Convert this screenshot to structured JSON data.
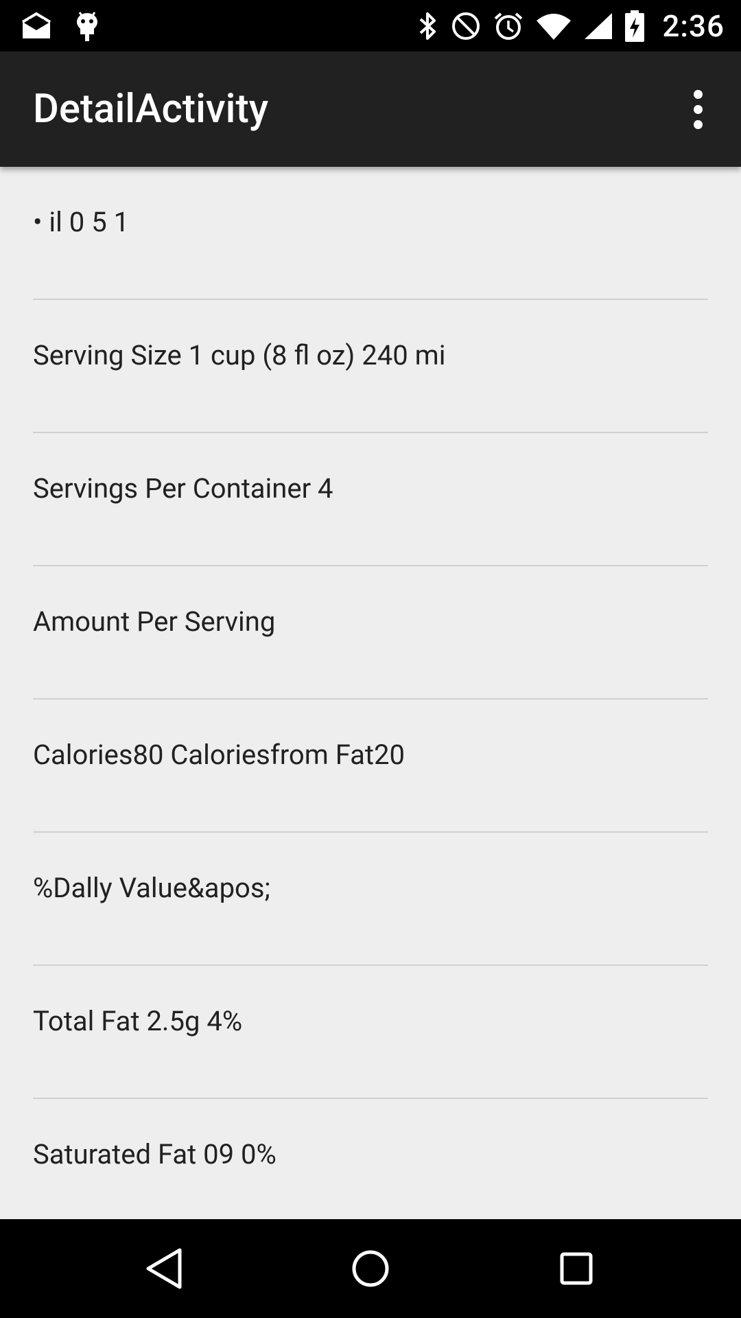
{
  "status_bar": {
    "time": "2:36",
    "icons": [
      "mail-icon",
      "android-debug-icon",
      "bluetooth-icon",
      "do-not-disturb-icon",
      "alarm-icon",
      "wifi-icon",
      "cell-signal-icon",
      "battery-charging-icon"
    ]
  },
  "app_bar": {
    "title": "DetailActivity",
    "overflow_icon": "more-vert-icon"
  },
  "list": {
    "items": [
      {
        "text": "• il 0 5 1"
      },
      {
        "text": "Serving Size 1 cup (8 fl oz) 240 mi"
      },
      {
        "text": "Servings Per Container 4"
      },
      {
        "text": "Amount Per Serving"
      },
      {
        "text": "Calories80 Caloriesfrom Fat20"
      },
      {
        "text": "%Dally Value&apos;"
      },
      {
        "text": "Total Fat 2.5g 4%"
      },
      {
        "text": "Saturated Fat 09 0%"
      }
    ]
  },
  "nav_bar": {
    "back_icon": "back-icon",
    "home_icon": "home-icon",
    "recents_icon": "recents-icon"
  },
  "colors": {
    "status_bar": "#000000",
    "app_bar": "#212121",
    "background": "#eeeeee",
    "text": "#212121",
    "divider": "#d0d0d0"
  }
}
